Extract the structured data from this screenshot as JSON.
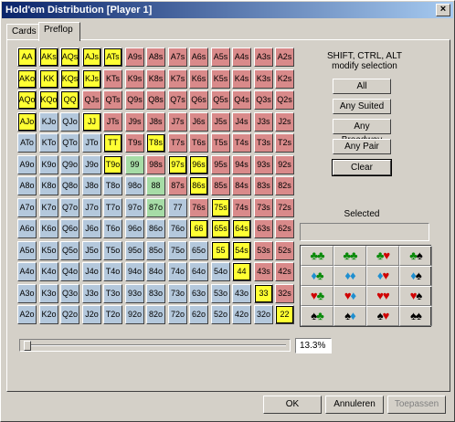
{
  "title": "Hold'em Distribution [Player 1]",
  "tabs": [
    "Cards",
    "Preflop"
  ],
  "modifier_hint": [
    "SHIFT, CTRL, ALT",
    "modify selection"
  ],
  "buttons": [
    "All",
    "Any Suited",
    "Any Broadway",
    "Any Pair",
    "Clear"
  ],
  "selected_label": "Selected",
  "percent": "13.3%",
  "slider_fraction": 0.133,
  "footer_buttons": {
    "ok": "OK",
    "cancel": "Annuleren",
    "apply": "Toepassen"
  },
  "colors": {
    "yellow": "#ffff33",
    "red": "#d98a8a",
    "blue": "#b4c8dc",
    "green": "#a6dca6"
  },
  "grid": [
    [
      "AA",
      "AKs",
      "AQs",
      "AJs",
      "ATs",
      "A9s",
      "A8s",
      "A7s",
      "A6s",
      "A5s",
      "A4s",
      "A3s",
      "A2s"
    ],
    [
      "AKo",
      "KK",
      "KQs",
      "KJs",
      "KTs",
      "K9s",
      "K8s",
      "K7s",
      "K6s",
      "K5s",
      "K4s",
      "K3s",
      "K2s"
    ],
    [
      "AQo",
      "KQo",
      "QQ",
      "QJs",
      "QTs",
      "Q9s",
      "Q8s",
      "Q7s",
      "Q6s",
      "Q5s",
      "Q4s",
      "Q3s",
      "Q2s"
    ],
    [
      "AJo",
      "KJo",
      "QJo",
      "JJ",
      "JTs",
      "J9s",
      "J8s",
      "J7s",
      "J6s",
      "J5s",
      "J4s",
      "J3s",
      "J2s"
    ],
    [
      "ATo",
      "KTo",
      "QTo",
      "JTo",
      "TT",
      "T9s",
      "T8s",
      "T7s",
      "T6s",
      "T5s",
      "T4s",
      "T3s",
      "T2s"
    ],
    [
      "A9o",
      "K9o",
      "Q9o",
      "J9o",
      "T9o",
      "99",
      "98s",
      "97s",
      "96s",
      "95s",
      "94s",
      "93s",
      "92s"
    ],
    [
      "A8o",
      "K8o",
      "Q8o",
      "J8o",
      "T8o",
      "98o",
      "88",
      "87s",
      "86s",
      "85s",
      "84s",
      "83s",
      "82s"
    ],
    [
      "A7o",
      "K7o",
      "Q7o",
      "J7o",
      "T7o",
      "97o",
      "87o",
      "77",
      "76s",
      "75s",
      "74s",
      "73s",
      "72s"
    ],
    [
      "A6o",
      "K6o",
      "Q6o",
      "J6o",
      "T6o",
      "96o",
      "86o",
      "76o",
      "66",
      "65s",
      "64s",
      "63s",
      "62s"
    ],
    [
      "A5o",
      "K5o",
      "Q5o",
      "J5o",
      "T5o",
      "95o",
      "85o",
      "75o",
      "65o",
      "55",
      "54s",
      "53s",
      "52s"
    ],
    [
      "A4o",
      "K4o",
      "Q4o",
      "J4o",
      "T4o",
      "94o",
      "84o",
      "74o",
      "64o",
      "54o",
      "44",
      "43s",
      "42s"
    ],
    [
      "A3o",
      "K3o",
      "Q3o",
      "J3o",
      "T3o",
      "93o",
      "83o",
      "73o",
      "63o",
      "53o",
      "43o",
      "33",
      "32s"
    ],
    [
      "A2o",
      "K2o",
      "Q2o",
      "J2o",
      "T2o",
      "92o",
      "82o",
      "72o",
      "62o",
      "52o",
      "42o",
      "32o",
      "22"
    ]
  ],
  "selected_hands": [
    "AA",
    "AKs",
    "AQs",
    "AJs",
    "ATs",
    "AKo",
    "KK",
    "KQs",
    "KJs",
    "AQo",
    "KQo",
    "QQ",
    "AJo",
    "JJ",
    "TT",
    "T8s",
    "T9o",
    "97s",
    "96s",
    "86s",
    "75s",
    "66",
    "65s",
    "64s",
    "55",
    "54s",
    "44",
    "33",
    "22"
  ],
  "suit_rows": [
    [
      [
        "♣♣",
        "green"
      ],
      [
        "♣♣",
        "green"
      ],
      [
        "♣♥",
        "green-red"
      ],
      [
        "♣♠",
        "green-black"
      ]
    ],
    [
      [
        "♦♣",
        "blue-green"
      ],
      [
        "♦♦",
        "blue"
      ],
      [
        "♦♥",
        "blue-red"
      ],
      [
        "♦♠",
        "blue-black"
      ]
    ],
    [
      [
        "♥♣",
        "red-green"
      ],
      [
        "♥♦",
        "red-blue"
      ],
      [
        "♥♥",
        "red"
      ],
      [
        "♥♠",
        "red-black"
      ]
    ],
    [
      [
        "♠♣",
        "black-green"
      ],
      [
        "♠♦",
        "black-blue"
      ],
      [
        "♠♥",
        "black-red"
      ],
      [
        "♠♠",
        "black"
      ]
    ]
  ]
}
